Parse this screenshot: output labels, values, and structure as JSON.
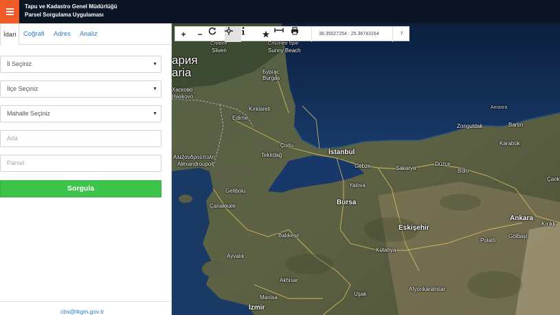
{
  "header": {
    "title_line1": "Tapu ve Kadastro Genel Müdürlüğü",
    "title_line2": "Parsel Sorgulama Uygulaması"
  },
  "sidebar": {
    "tabs": [
      {
        "label": "İdari",
        "active": true
      },
      {
        "label": "Coğrafi"
      },
      {
        "label": "Adres"
      },
      {
        "label": "Analiz"
      }
    ],
    "il_select": "İl Seçiniz",
    "ilce_select": "İlçe Seçiniz",
    "mahalle_select": "Mahalle Seçiniz",
    "ada_placeholder": "Ada",
    "parsel_placeholder": "Parsel",
    "submit_label": "Sorgula",
    "footer_email": "cbs@tkgm.gov.tr"
  },
  "map": {
    "toolbar": {
      "buttons": [
        "zoom-in",
        "zoom-out",
        "refresh",
        "pan",
        "info",
        "favorite",
        "measure",
        "print"
      ],
      "coordinates": "38.35027254 : 25.36743164",
      "zoom_level": "7"
    },
    "labels": {
      "sliven_bg": "Сливен",
      "sliven": "Sliven",
      "sunny_beach_bg": "Слънчев бряг",
      "sunny_beach": "Sunny Beach",
      "burgas_bg": "Бургас",
      "burgas": "Burgas",
      "bulgaria_bg": "ария",
      "bulgaria": "aria",
      "haskovo_bg": "Хасково",
      "haskovo": "Haskovo",
      "kirklareli": "Kırklareli",
      "edirne": "Edirne",
      "amasra": "Amasra",
      "bartin": "Bartın",
      "zonguldak": "Zonguldak",
      "karabuk": "Karabük",
      "corlu": "Çorlu",
      "alexandroupoli_gr": "Αλεξανδρούπολη",
      "alexandroupoli": "Alexandroupoli",
      "tekirdag": "Tekirdağ",
      "istanbul": "İstanbul",
      "gebze": "Gebze",
      "sakarya": "Sakarya",
      "duzce": "Düzce",
      "bolu": "Bolu",
      "cankiri": "Çank",
      "gelibolu": "Gelibolu",
      "yalova": "Yalova",
      "canakkale": "Çanakkale",
      "bursa": "Bursa",
      "eskisehir": "Eskişehir",
      "ankara": "Ankara",
      "kirikkale": "Kırıkk",
      "golbasi": "Gölbaşı",
      "balikesir": "Balıkesir",
      "polatli": "Polatlı",
      "ayvalik": "Ayvalık",
      "kutahya": "Kütahya",
      "akhisar": "Akhisar",
      "afyonkarahisar": "Afyonkarahisar",
      "usak": "Uşak",
      "manisa": "Manisa",
      "izmir": "İzmir"
    }
  }
}
